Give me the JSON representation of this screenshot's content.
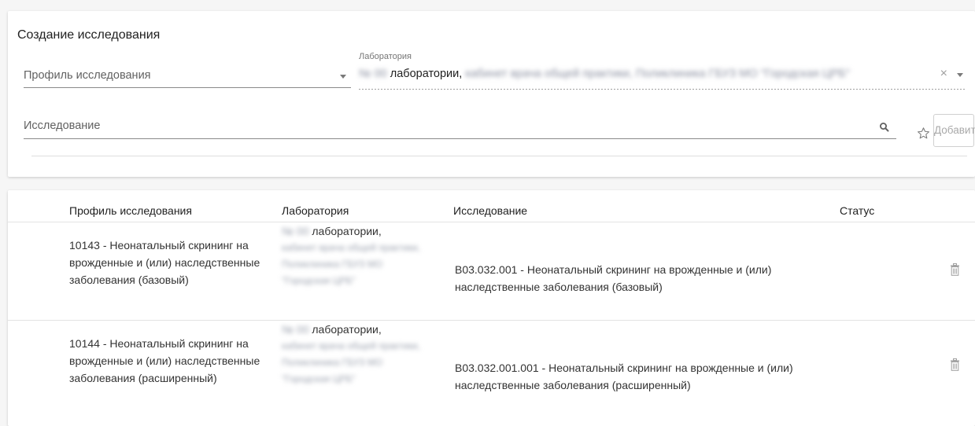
{
  "create_section": {
    "title": "Создание исследования",
    "profile_field": {
      "placeholder": "Профиль исследования"
    },
    "lab_field": {
      "label": "Лаборатория",
      "value_prefix": "№ 00",
      "value_visible": " лаборатории,",
      "value_blurred": "кабинет врача общей практики, Поликлиника ГБУЗ МО \"Городская ЦРБ\""
    },
    "research_field": {
      "placeholder": "Исследование"
    },
    "add_button": "Добавить"
  },
  "table": {
    "columns": [
      "Профиль исследования",
      "Лаборатория",
      "Исследование",
      "Статус"
    ],
    "rows": [
      {
        "profile": "10143 - Неонатальный скрининг на врожденные и (или) наследственные заболевания (базовый)",
        "lab_code": "№ 00",
        "lab_visible": " лаборатории,",
        "lab_blurred": "кабинет врача общей практики, Поликлиника ГБУЗ МО \"Городская ЦРБ\"",
        "research": "B03.032.001 - Неонатальный скрининг на врожденные и (или) наследственные заболевания (базовый)",
        "status": ""
      },
      {
        "profile": "10144 - Неонатальный скрининг на врожденные и (или) наследственные заболевания (расширенный)",
        "lab_code": "№ 00",
        "lab_visible": " лаборатории,",
        "lab_blurred": "кабинет врача общей практики, Поликлиника ГБУЗ МО \"Городская ЦРБ\"",
        "research": "B03.032.001.001 - Неонатальный скрининг на врожденные и (или) наследственные заболевания (расширенный)",
        "status": ""
      }
    ]
  },
  "colors": {
    "text": "#212121",
    "muted": "#757575",
    "disabled": "#a9a9a9",
    "divider": "#e3e3e3"
  },
  "icons": [
    "chevron-down-icon",
    "close-icon",
    "search-icon",
    "star-icon",
    "trash-icon"
  ]
}
